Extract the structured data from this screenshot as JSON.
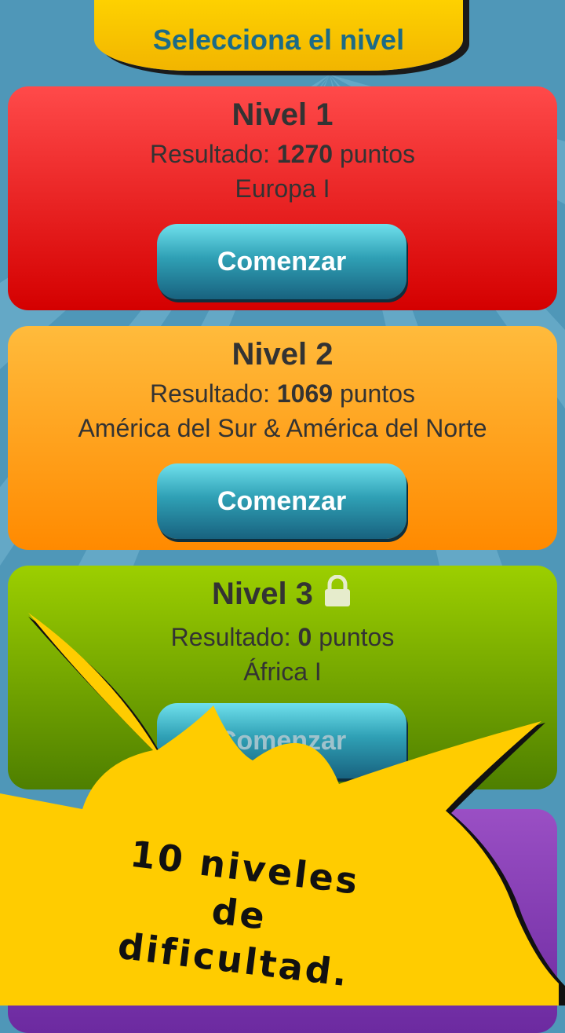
{
  "header": {
    "title": "Selecciona el nivel"
  },
  "levels": [
    {
      "title": "Nivel 1",
      "score_prefix": "Resultado: ",
      "score": "1270",
      "score_suffix": " puntos",
      "region": "Europa I",
      "button": "Comenzar",
      "locked": false,
      "color": "#e82020"
    },
    {
      "title": "Nivel 2",
      "score_prefix": "Resultado: ",
      "score": "1069",
      "score_suffix": " puntos",
      "region": "América del Sur & América del Norte",
      "button": "Comenzar",
      "locked": false,
      "color": "#ff9f1a"
    },
    {
      "title": "Nivel 3",
      "score_prefix": "Resultado: ",
      "score": "0",
      "score_suffix": " puntos",
      "region": "África I",
      "button": "Comenzar",
      "locked": true,
      "color": "#7aa800"
    }
  ],
  "promo": {
    "line1": "10 niveles",
    "line2": "de dificultad."
  },
  "icons": {
    "lock": "lock-icon"
  },
  "colors": {
    "background": "#4f97b8",
    "header": "#ffd400",
    "header_text": "#1c6b86",
    "button": "#2fa0b5",
    "burst": "#ffcc00",
    "card4": "#8a3fba"
  }
}
